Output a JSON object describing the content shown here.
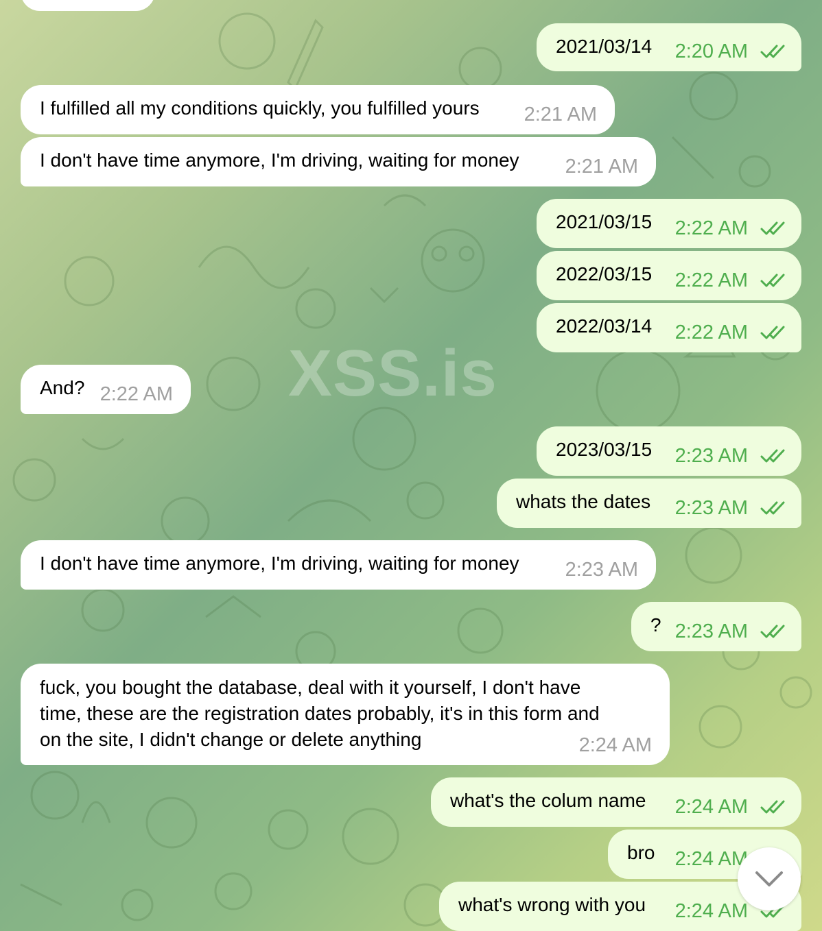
{
  "watermark": "XSS.is",
  "colors": {
    "incoming_bubble": "#ffffff",
    "outgoing_bubble": "#effdde",
    "outgoing_time": "#4fae4e",
    "incoming_time": "#a0a0a0"
  },
  "messages": [
    {
      "dir": "out",
      "text": "2021/03/14",
      "time": "2:20 AM",
      "read": true
    },
    {
      "dir": "in",
      "text": "I fulfilled all my conditions quickly, you fulfilled yours",
      "time": "2:21 AM"
    },
    {
      "dir": "in",
      "text": "I don't have time anymore, I'm driving, waiting for money",
      "time": "2:21 AM"
    },
    {
      "dir": "out",
      "text": "2021/03/15",
      "time": "2:22 AM",
      "read": true
    },
    {
      "dir": "out",
      "text": "2022/03/15",
      "time": "2:22 AM",
      "read": true
    },
    {
      "dir": "out",
      "text": "2022/03/14",
      "time": "2:22 AM",
      "read": true
    },
    {
      "dir": "in",
      "text": "And?",
      "time": "2:22 AM"
    },
    {
      "dir": "out",
      "text": "2023/03/15",
      "time": "2:23 AM",
      "read": true
    },
    {
      "dir": "out",
      "text": "whats the dates",
      "time": "2:23 AM",
      "read": true
    },
    {
      "dir": "in",
      "text": "I don't have time anymore, I'm driving, waiting for money",
      "time": "2:23 AM"
    },
    {
      "dir": "out",
      "text": "?",
      "time": "2:23 AM",
      "read": true
    },
    {
      "dir": "in",
      "text": "fuck, you bought the database, deal with it yourself, I don't have\ntime, these are the registration dates probably, it's in this form and\non the site, I didn't change or delete anything",
      "time": "2:24 AM"
    },
    {
      "dir": "out",
      "text": "what's the colum name",
      "time": "2:24 AM",
      "read": true
    },
    {
      "dir": "out",
      "text": "bro",
      "time": "2:24 AM",
      "read": true
    },
    {
      "dir": "out",
      "text": "what's wrong with you",
      "time": "2:24 AM",
      "read": true
    }
  ],
  "scroll_button_icon": "chevron-down-icon"
}
